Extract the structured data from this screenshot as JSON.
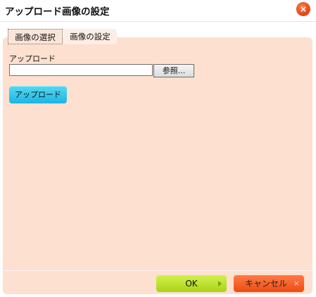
{
  "dialog": {
    "title": "アップロード画像の設定",
    "close_glyph": "×"
  },
  "tabs": [
    {
      "label": "画像の選択"
    },
    {
      "label": "画像の設定"
    }
  ],
  "upload_form": {
    "label": "アップロード",
    "file_value": "",
    "browse_label": "参照...",
    "upload_label": "アップロード"
  },
  "footer": {
    "ok_label": "OK",
    "cancel_label": "キャンセル",
    "cancel_glyph": "×"
  },
  "colors": {
    "panel_bg": "#fde0cf",
    "upload_button": "#1eb4e2",
    "ok_button": "#a8d41a",
    "cancel_button": "#ee4c12",
    "close_button": "#f04a16"
  },
  "icons": {
    "close": "close-icon",
    "ok_arrow": "arrow-right-icon",
    "cancel_x": "close-icon"
  }
}
